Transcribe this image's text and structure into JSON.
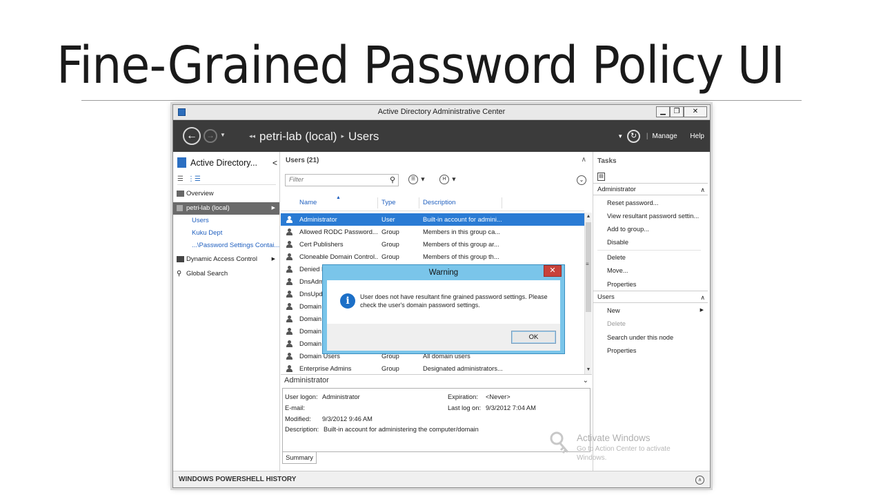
{
  "slide": {
    "title": "Fine-Grained Password Policy UI"
  },
  "window": {
    "title": "Active Directory Administrative Center",
    "controls": {
      "minimize": "▁",
      "restore": "❐",
      "close": "✕"
    }
  },
  "navbar": {
    "back_icon": "arrow-left-icon",
    "forward_icon": "arrow-right-icon",
    "breadcrumb": [
      "petri-lab (local)",
      "Users"
    ],
    "manage_label": "Manage",
    "help_label": "Help"
  },
  "left_pane": {
    "title": "Active Directory...",
    "items": [
      {
        "label": "Overview"
      },
      {
        "label": "petri-lab (local)",
        "selected": true
      },
      {
        "label": "Dynamic Access Control"
      },
      {
        "label": "Global Search"
      }
    ],
    "children": [
      "Users",
      "Kuku Dept",
      "...\\Password Settings Contai..."
    ]
  },
  "center": {
    "header": "Users  (21)",
    "filter_placeholder": "Filter",
    "columns": [
      "Name",
      "Type",
      "Description"
    ],
    "rows": [
      {
        "name": "Administrator",
        "type": "User",
        "desc": "Built-in account for admini...",
        "selected": true
      },
      {
        "name": "Allowed RODC Password...",
        "type": "Group",
        "desc": "Members in this group ca..."
      },
      {
        "name": "Cert Publishers",
        "type": "Group",
        "desc": "Members of this group ar..."
      },
      {
        "name": "Cloneable Domain Control...",
        "type": "Group",
        "desc": "Members of this group th..."
      },
      {
        "name": "Denied RODC",
        "type": "",
        "desc": ""
      },
      {
        "name": "DnsAdmins",
        "type": "",
        "desc": ""
      },
      {
        "name": "DnsUpdateProxy",
        "type": "",
        "desc": ""
      },
      {
        "name": "Domain",
        "type": "",
        "desc": ""
      },
      {
        "name": "Domain",
        "type": "",
        "desc": ""
      },
      {
        "name": "Domain",
        "type": "",
        "desc": ""
      },
      {
        "name": "Domain",
        "type": "",
        "desc": ""
      },
      {
        "name": "Domain Users",
        "type": "Group",
        "desc": "All domain users"
      },
      {
        "name": "Enterprise Admins",
        "type": "Group",
        "desc": "Designated administrators..."
      }
    ]
  },
  "details": {
    "title": "Administrator",
    "user_logon_label": "User logon:",
    "user_logon_value": "Administrator",
    "email_label": "E-mail:",
    "modified_label": "Modified:",
    "modified_value": "9/3/2012 9:46 AM",
    "description_label": "Description:",
    "description_value": "Built-in account for administering the computer/domain",
    "expiration_label": "Expiration:",
    "expiration_value": "<Never>",
    "last_logon_label": "Last log on:",
    "last_logon_value": "9/3/2012 7:04 AM",
    "summary_tab": "Summary"
  },
  "tasks": {
    "title": "Tasks",
    "admin_group": "Administrator",
    "admin_items": [
      "Reset password...",
      "View resultant password settin...",
      "Add to group...",
      "Disable",
      "Delete",
      "Move...",
      "Properties"
    ],
    "users_group": "Users",
    "users_items": [
      "New",
      "Delete",
      "Search under this node",
      "Properties"
    ]
  },
  "powershell": {
    "label": "WINDOWS POWERSHELL HISTORY"
  },
  "watermark": {
    "title": "Activate Windows",
    "line1": "Go to Action Center to activate",
    "line2": "Windows."
  },
  "dialog": {
    "title": "Warning",
    "close": "✕",
    "message": "User does not have resultant fine grained password settings. Please check the user's domain password settings.",
    "ok_label": "OK"
  }
}
